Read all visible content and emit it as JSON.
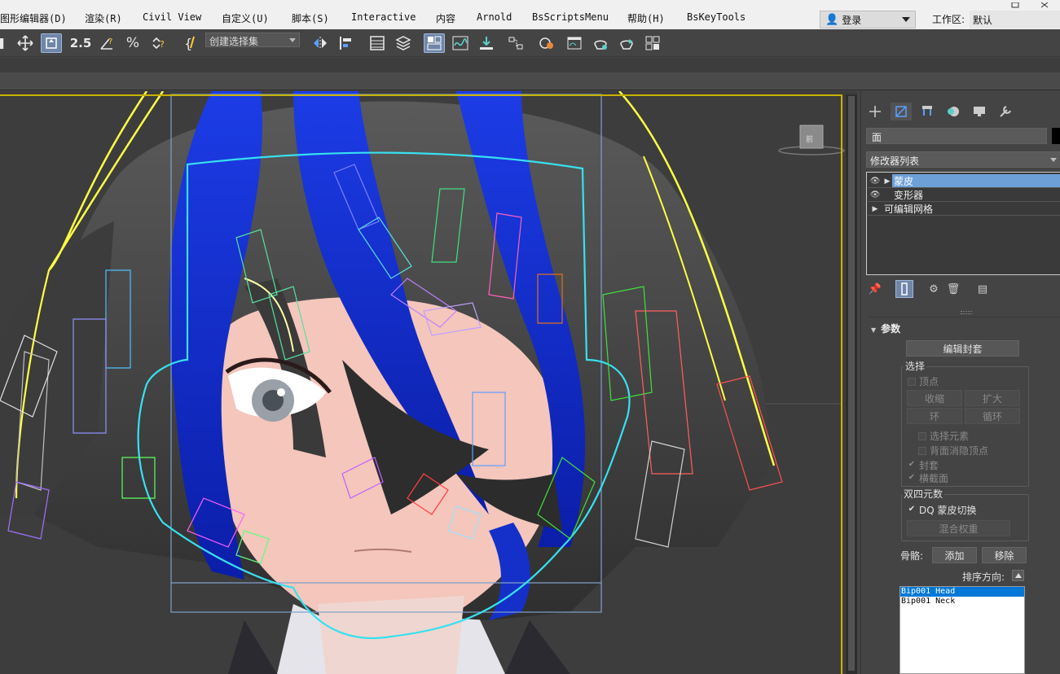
{
  "menu": [
    "图形编辑器(D)",
    "渲染(R)",
    "Civil View",
    "自定义(U)",
    "脚本(S)",
    "Interactive",
    "内容",
    "Arnold",
    "BsScriptsMenu",
    "帮助(H)",
    "BsKeyTools"
  ],
  "login": {
    "label": "登录"
  },
  "workspace": {
    "label": "工作区:",
    "value": "默认"
  },
  "toolbar": {
    "selection_set_placeholder": "创建选择集",
    "snap_label": "2.5"
  },
  "panel": {
    "object_name": "面",
    "modifier_list_label": "修改器列表",
    "stack": [
      {
        "name": "蒙皮",
        "selected": true,
        "eye": true,
        "arrow": true
      },
      {
        "name": "变形器",
        "selected": false,
        "eye": true,
        "arrow": false
      },
      {
        "name": "可编辑网格",
        "selected": false,
        "eye": false,
        "arrow": true
      }
    ],
    "rollout_title": "参数",
    "edit_envelope": "编辑封套",
    "select_group": "选择",
    "vertices": "顶点",
    "shrink": "收缩",
    "grow": "扩大",
    "ring": "环",
    "loop": "循环",
    "select_element": "选择元素",
    "backface_cull": "背面消隐顶点",
    "envelopes": "封套",
    "cross_sections": "横截面",
    "dq_group": "双四元数",
    "dq_toggle": "DQ 蒙皮切换",
    "blend_weights": "混合权重",
    "bones_label": "骨骼:",
    "add": "添加",
    "remove": "移除",
    "sort_label": "排序方向:",
    "bones": [
      "Bip001 Head",
      "Bip001 Neck"
    ]
  },
  "colors": {
    "accent": "#6f86a8",
    "viewport_border": "#c9b200",
    "selection_highlight": "#6ea0d8"
  }
}
